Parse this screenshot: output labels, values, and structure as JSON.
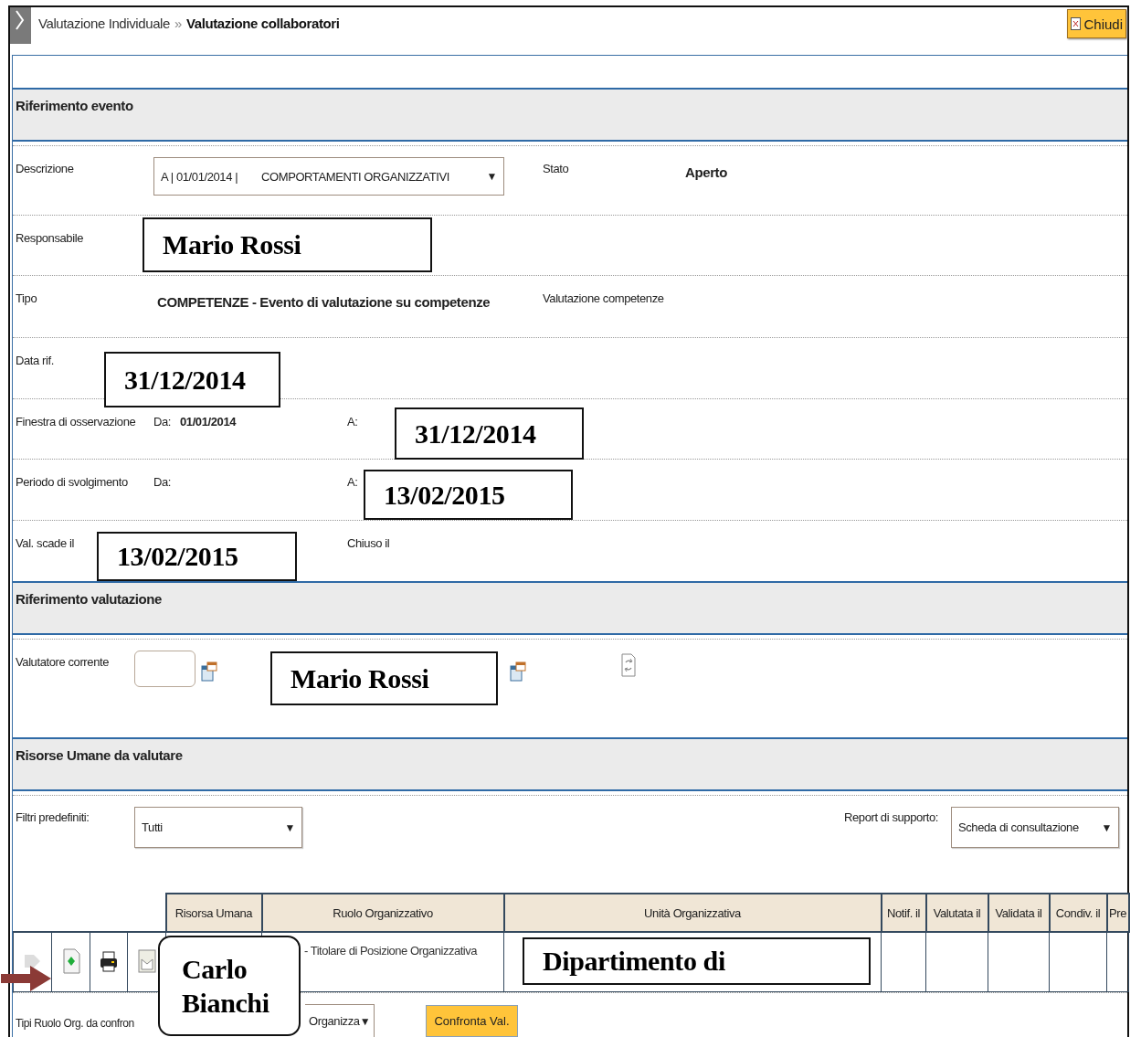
{
  "breadcrumb": {
    "parent": "Valutazione Individuale",
    "separator": "»",
    "current": "Valutazione collaboratori"
  },
  "close_button": {
    "label": "Chiudi"
  },
  "event_section": {
    "title": "Riferimento evento",
    "rows": [
      {
        "label": "Descrizione",
        "select": {
          "code": "A | 01/01/2014 |",
          "text": "COMPORTAMENTI ORGANIZZATIVI",
          "arrow": "▼"
        },
        "side_label": "Stato",
        "side_value": "Aperto"
      },
      {
        "label": "Responsabile",
        "note": "Mario Rossi"
      },
      {
        "label": "Tipo",
        "value": "COMPETENZE - Evento di valutazione su competenze",
        "side_label": "Valutazione competenze"
      },
      {
        "label": "Data rif.",
        "note": "31/12/2014"
      },
      {
        "label": "Finestra di osservazione",
        "from_label": "Da:",
        "from_value": "01/01/2014",
        "to_label": "A:",
        "note": "31/12/2014"
      },
      {
        "label": "Periodo di svolgimento",
        "from_label": "Da:",
        "to_label": "A:",
        "note": "13/02/2015"
      },
      {
        "label": "Val. scade il",
        "to_label": "Chiuso il",
        "note": "13/02/2015"
      }
    ]
  },
  "evaluation_section": {
    "title": "Riferimento valutazione",
    "evaluator": {
      "label": "Valutatore corrente",
      "note": "Mario Rossi"
    }
  },
  "resources_section": {
    "title": "Risorse Umane da valutare",
    "filter": {
      "label": "Filtri predefiniti:",
      "value": "Tutti",
      "arrow": "▼"
    },
    "report": {
      "label": "Report di supporto:",
      "value": "Scheda di consultazione",
      "arrow": "▼"
    },
    "table": {
      "columns": [
        "Risorsa Umana",
        "Ruolo Organizzativo",
        "Unità Organizzativa",
        "Notif. il",
        "Valutata il",
        "Validata il",
        "Condiv. il",
        "Pre"
      ],
      "rows": [
        {
          "resource_note": "Carlo Bianchi",
          "role": "- Titolare di Posizione Organizzativa",
          "unit_note": "Dipartimento di"
        }
      ]
    },
    "compare": {
      "label": "Tipi Ruolo Org. da confron",
      "select_value": "Organizza",
      "arrow": "▼",
      "button": "Confronta Val."
    }
  }
}
